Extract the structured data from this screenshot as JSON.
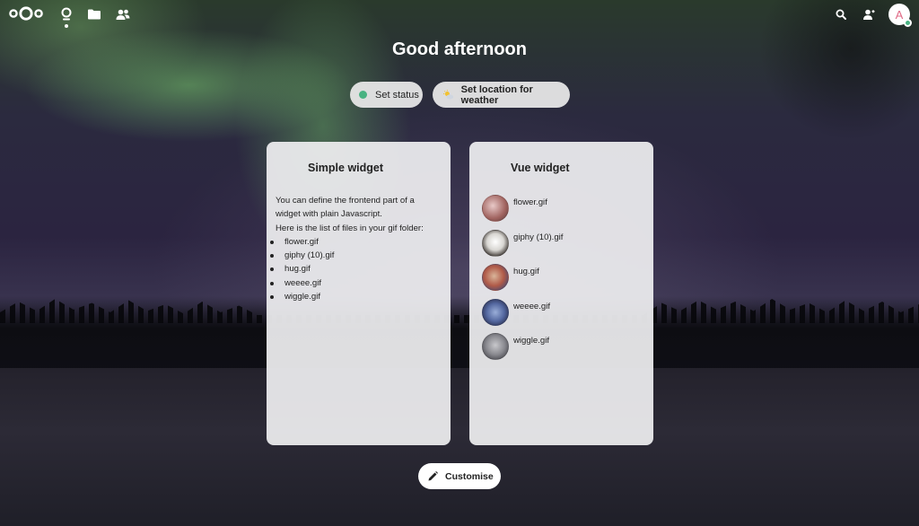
{
  "header": {
    "nav": [
      {
        "name": "dashboard",
        "icon": "dashboard-icon"
      },
      {
        "name": "files",
        "icon": "folder-icon"
      },
      {
        "name": "contacts",
        "icon": "contacts-icon"
      }
    ],
    "right_icons": [
      "search-icon",
      "contacts-menu-icon"
    ],
    "avatar_initial": "A"
  },
  "greeting": "Good afternoon",
  "status": {
    "set_status_label": "Set status",
    "weather_label": "Set location for weather"
  },
  "simple_widget": {
    "title": "Simple widget",
    "intro_line1": "You can define the frontend part of a",
    "intro_line2": "widget with plain Javascript.",
    "intro_line3": "Here is the list of files in your gif folder:",
    "files": [
      "flower.gif",
      "giphy (10).gif",
      "hug.gif",
      "weeee.gif",
      "wiggle.gif"
    ]
  },
  "vue_widget": {
    "title": "Vue widget",
    "files": [
      "flower.gif",
      "giphy (10).gif",
      "hug.gif",
      "weeee.gif",
      "wiggle.gif"
    ]
  },
  "customise_label": "Customise",
  "colors": {
    "online": "#49b382",
    "accent_avatar": "#e06a86"
  }
}
